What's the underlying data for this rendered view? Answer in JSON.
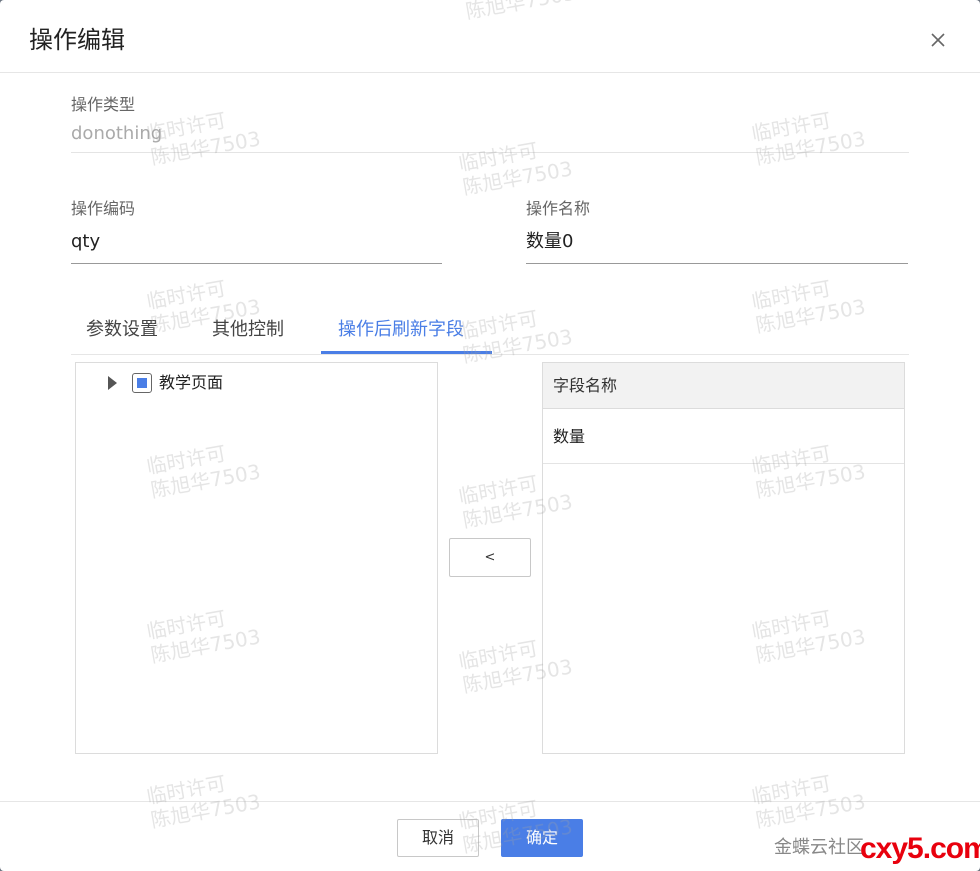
{
  "dialog": {
    "title": "操作编辑"
  },
  "fields": {
    "op_type_label": "操作类型",
    "op_type_value": "donothing",
    "op_code_label": "操作编码",
    "op_code_value": "qty",
    "op_name_label": "操作名称",
    "op_name_value": "数量0"
  },
  "tabs": [
    {
      "label": "参数设置",
      "active": false
    },
    {
      "label": "其他控制",
      "active": false
    },
    {
      "label": "操作后刷新字段",
      "active": true
    }
  ],
  "tree": {
    "nodes": [
      {
        "label": "教学页面",
        "expanded": false,
        "checked": "partial"
      }
    ]
  },
  "move_button": {
    "label": "<"
  },
  "grid": {
    "column_header": "字段名称",
    "rows": [
      {
        "field_name": "数量"
      }
    ]
  },
  "footer": {
    "cancel_label": "取消",
    "ok_label": "确定"
  },
  "watermark": {
    "line1": "临时许可",
    "line2": "陈旭华7503"
  },
  "site_watermark": {
    "text": "金蝶云社区",
    "logo": "cxy5.com"
  },
  "colors": {
    "accent": "#4a7ee6",
    "logo_red": "#e8000d"
  },
  "icons": {
    "close": "close-icon",
    "tree_expand": "caret-right-icon",
    "tree_check": "checkbox-partial-icon"
  }
}
